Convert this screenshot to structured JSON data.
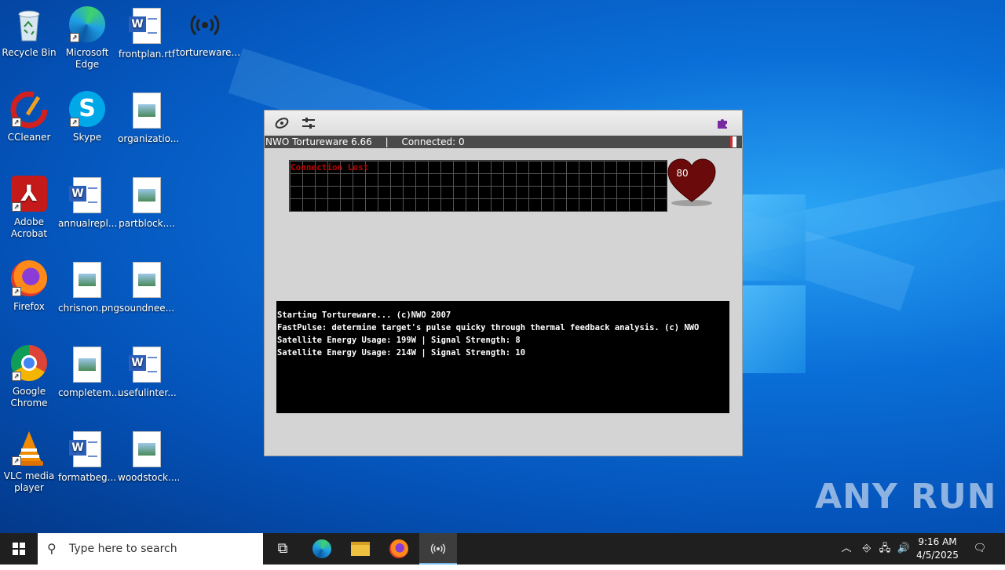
{
  "desktop": {
    "icons": [
      {
        "label": "Recycle Bin",
        "icon": "recycle-bin-icon"
      },
      {
        "label": "Microsoft Edge",
        "icon": "edge-icon"
      },
      {
        "label": "frontplan.rtf",
        "icon": "word-doc-icon"
      },
      {
        "label": "tortureware...",
        "icon": "broadcast-icon"
      },
      {
        "label": "CCleaner",
        "icon": "ccleaner-icon"
      },
      {
        "label": "Skype",
        "icon": "skype-icon"
      },
      {
        "label": "organizatio...",
        "icon": "image-file-icon"
      },
      {
        "label": "Adobe Acrobat",
        "icon": "acrobat-icon"
      },
      {
        "label": "annualrepl...",
        "icon": "word-doc-icon"
      },
      {
        "label": "partblock....",
        "icon": "image-file-icon"
      },
      {
        "label": "Firefox",
        "icon": "firefox-icon"
      },
      {
        "label": "chrisnon.png",
        "icon": "image-file-icon"
      },
      {
        "label": "soundnee...",
        "icon": "image-file-icon"
      },
      {
        "label": "Google Chrome",
        "icon": "chrome-icon"
      },
      {
        "label": "completem...",
        "icon": "image-file-icon"
      },
      {
        "label": "usefulinter...",
        "icon": "word-doc-icon"
      },
      {
        "label": "VLC media player",
        "icon": "vlc-icon"
      },
      {
        "label": "formatbeg...",
        "icon": "word-doc-icon"
      },
      {
        "label": "woodstock....",
        "icon": "image-file-icon"
      }
    ]
  },
  "app": {
    "status_title": "NWO Tortureware 6.66",
    "status_sep": "|",
    "connected": "Connected: 0",
    "graph_label": "Connection Lost",
    "heart_value": "80",
    "console_lines": [
      "Starting Tortureware... (c)NWO 2007",
      "FastPulse: determine target's pulse quicky through thermal feedback analysis. (c) NWO",
      "Satellite Energy Usage: 199W  | Signal Strength: 8",
      "Satellite Energy Usage: 214W  | Signal Strength: 10"
    ]
  },
  "watermark": "ANY RUN",
  "taskbar": {
    "search_placeholder": "Type here to search",
    "clock_time": "9:16 AM",
    "clock_date": "4/5/2025"
  },
  "colors": {
    "desktop_blue": "#0a6fd8",
    "taskbar": "#1f1f1f",
    "heart": "#6b0a0a",
    "graph_text": "#c00000"
  }
}
